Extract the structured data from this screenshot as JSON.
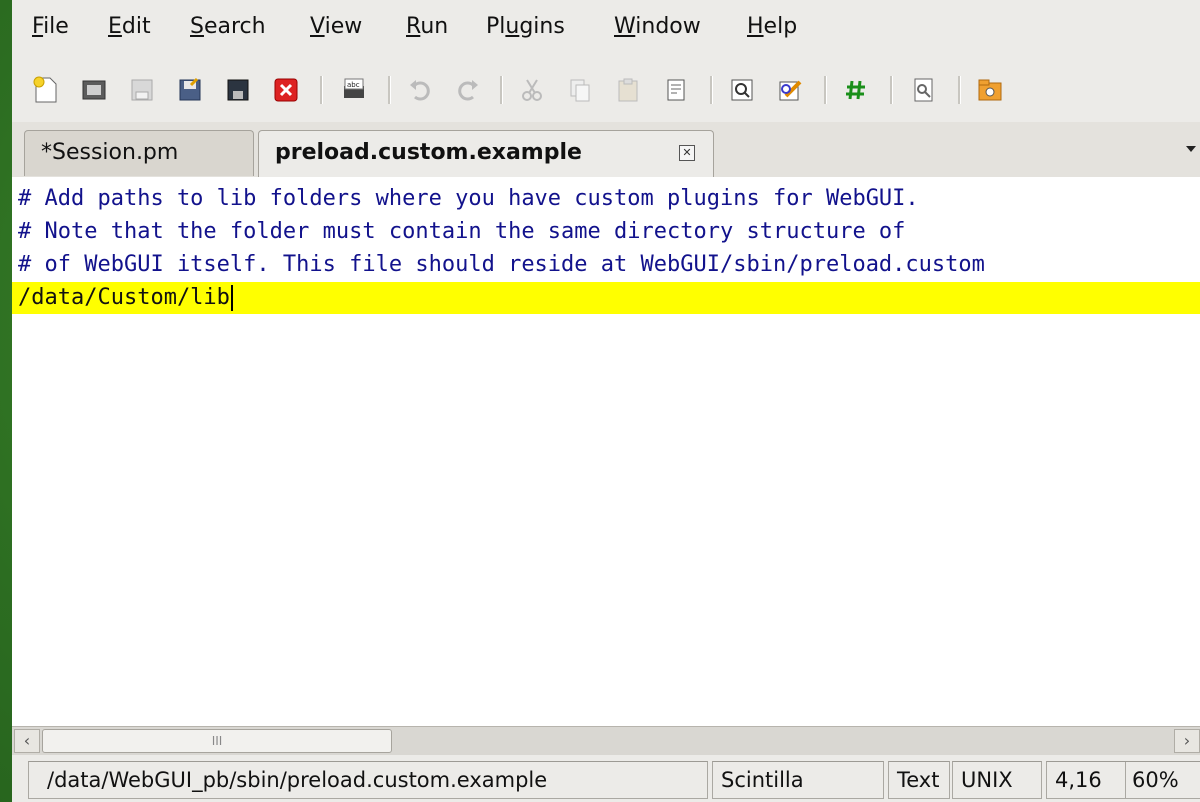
{
  "menu": {
    "file": "File",
    "edit": "Edit",
    "search": "Search",
    "view": "View",
    "run": "Run",
    "plugins": "Plugins",
    "window": "Window",
    "help": "Help"
  },
  "toolbar": {
    "icons": [
      "new-file-icon",
      "open-file-icon",
      "save-icon",
      "save-all-icon",
      "save-as-icon",
      "close-icon",
      "spellcheck-icon",
      "undo-icon",
      "redo-icon",
      "cut-icon",
      "copy-icon",
      "paste-icon",
      "delete-icon",
      "find-icon",
      "find-replace-icon",
      "comment-icon",
      "find-in-files-icon",
      "open-folder-icon"
    ]
  },
  "tabs": [
    {
      "label": "*Session.pm",
      "active": false
    },
    {
      "label": "preload.custom.example",
      "active": true,
      "close": "✕"
    }
  ],
  "editor": {
    "lines": [
      "# Add paths to lib folders where you have custom plugins for WebGUI.",
      "# Note that the folder must contain the same directory structure of",
      "# of WebGUI itself. This file should reside at WebGUI/sbin/preload.custom",
      "/data/Custom/lib"
    ],
    "current_line_color": "#ffff00",
    "comment_color": "#12128c"
  },
  "scrollbar": {
    "thumb_mark": "III"
  },
  "status": {
    "path": "/data/WebGUI_pb/sbin/preload.custom.example",
    "lexer": "Scintilla",
    "mode": "Text",
    "eol": "UNIX",
    "position": "4,16",
    "zoom": "60%"
  }
}
